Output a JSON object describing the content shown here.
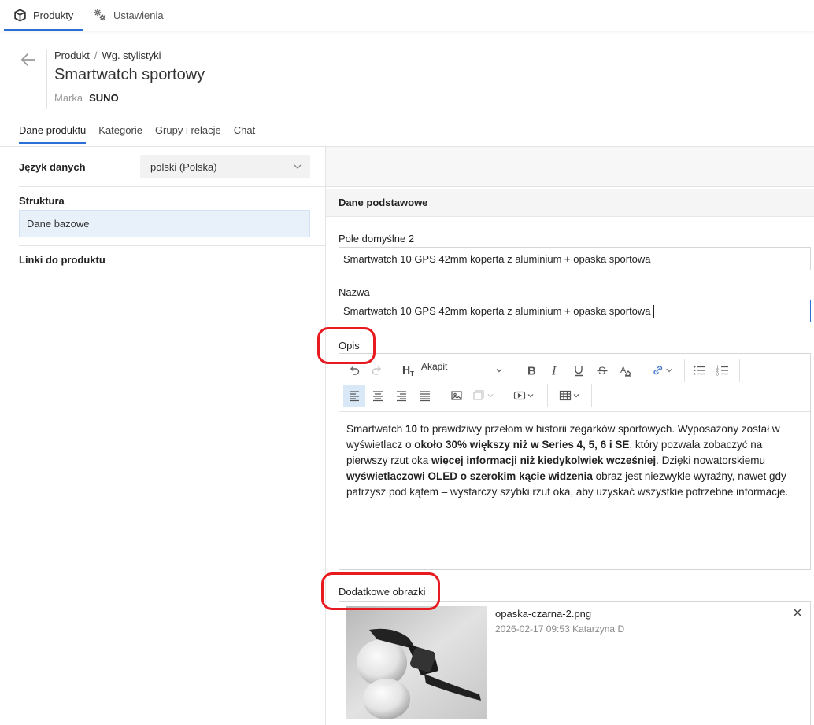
{
  "nav": {
    "products": "Produkty",
    "settings": "Ustawienia"
  },
  "header": {
    "breadcrumb_1": "Produkt",
    "breadcrumb_sep": "/",
    "breadcrumb_2": "Wg. stylistyki",
    "title": "Smartwatch sportowy",
    "brand_label": "Marka",
    "brand_value": "SUNO"
  },
  "tabs": [
    "Dane produktu",
    "Kategorie",
    "Grupy i relacje",
    "Chat"
  ],
  "left": {
    "language_label": "Język danych",
    "language_value": "polski (Polska)",
    "structure_label": "Struktura",
    "structure_item": "Dane bazowe",
    "links_label": "Linki do produktu"
  },
  "right": {
    "section_title": "Dane podstawowe",
    "field1_label": "Pole domyślne 2",
    "field1_value": "Smartwatch 10 GPS 42mm koperta z aluminium + opaska sportowa",
    "field2_label": "Nazwa",
    "field2_value": "Smartwatch 10 GPS 42mm koperta z aluminium + opaska sportowa",
    "desc_label": "Opis",
    "heading_select": "Akapit",
    "images_label": "Dodatkowe obrazki",
    "image_name": "opaska-czarna-2.png",
    "image_meta": "2026-02-17 09:53 Katarzyna D"
  },
  "description": {
    "p1": "Smartwatch ",
    "b1": "10",
    "p2": " to prawdziwy przełom w historii zegarków sportowych. Wyposażony został w wyświetlacz o ",
    "b2": "około 30% większy niż w Series 4, 5, 6 i SE",
    "p3": ", który pozwala zobaczyć na pierwszy rzut oka ",
    "b3": "więcej informacji niż kiedykolwiek wcześniej",
    "p4": ". Dzięki nowatorskiemu ",
    "b4": "wyświetlaczowi OLED o szerokim kącie widzenia",
    "p5": " obraz jest niezwykle wyraźny, nawet gdy patrzysz pod kątem – wystarczy szybki rzut oka, aby uzyskać wszystkie potrzebne informacje."
  },
  "colors": {
    "accent": "#2a6fd6",
    "annotation": "#e8191f",
    "selected_bg": "#e8f1fa"
  }
}
